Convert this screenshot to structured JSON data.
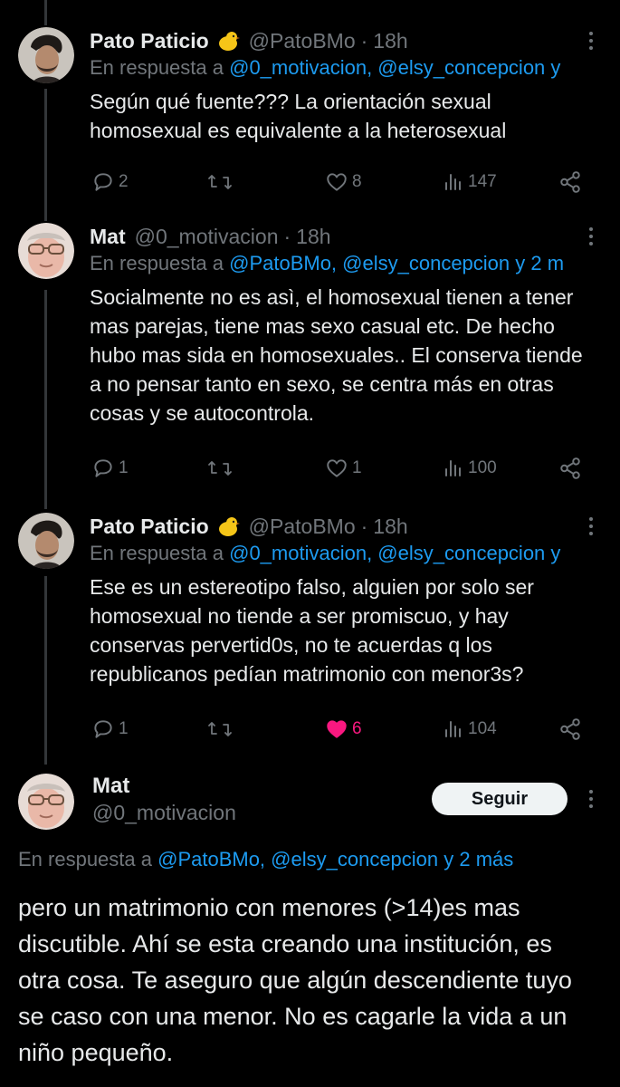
{
  "tweets": [
    {
      "name": "Pato Paticio",
      "handle": "@PatoBMo",
      "dot": "·",
      "time": "18h",
      "reply_prefix": "En respuesta a ",
      "reply_links": "@0_motivacion, @elsy_concepcion y",
      "text": "Según qué fuente??? La orientación sexual homosexual es equivalente a la heterosexual",
      "replies": "2",
      "likes": "8",
      "views": "147",
      "liked": false
    },
    {
      "name": "Mat",
      "handle": "@0_motivacion",
      "dot": "·",
      "time": "18h",
      "reply_prefix": "En respuesta a ",
      "reply_links": "@PatoBMo, @elsy_concepcion y 2 m",
      "text": "Socialmente no es asì, el homosexual tienen a tener mas parejas, tiene mas sexo casual etc. De hecho hubo mas sida en homosexuales.. El conserva tiende a no pensar tanto en sexo, se centra más en otras cosas y se autocontrola.",
      "replies": "1",
      "likes": "1",
      "views": "100",
      "liked": false
    },
    {
      "name": "Pato Paticio",
      "handle": "@PatoBMo",
      "dot": "·",
      "time": "18h",
      "reply_prefix": "En respuesta a ",
      "reply_links": "@0_motivacion, @elsy_concepcion y",
      "text": "Ese es un estereotipo falso, alguien por solo ser homosexual no tiende a ser promiscuo, y hay conservas pervertid0s, no te acuerdas q los republicanos pedían matrimonio con menor3s?",
      "replies": "1",
      "likes": "6",
      "views": "104",
      "liked": true
    }
  ],
  "main": {
    "name": "Mat",
    "handle": "@0_motivacion",
    "follow_label": "Seguir",
    "reply_prefix": "En respuesta a ",
    "reply_links": "@PatoBMo, @elsy_concepcion y 2 más",
    "text": "pero un matrimonio con menores (>14)es mas discutible. Ahí se esta creando una institución, es otra cosa. Te aseguro que algún descendiente tuyo se caso con una menor. No es cagarle la vida a  un niño pequeño."
  },
  "icons": {
    "reply": "reply-icon",
    "retweet": "retweet-icon",
    "like": "heart-icon",
    "views": "views-icon",
    "share": "share-icon",
    "more": "more-icon",
    "emoji": "chick-emoji-icon"
  },
  "colors": {
    "background": "#000000",
    "text": "#e7e9ea",
    "secondary": "#71767b",
    "link": "#1d9bf0",
    "like_active": "#f91880"
  }
}
